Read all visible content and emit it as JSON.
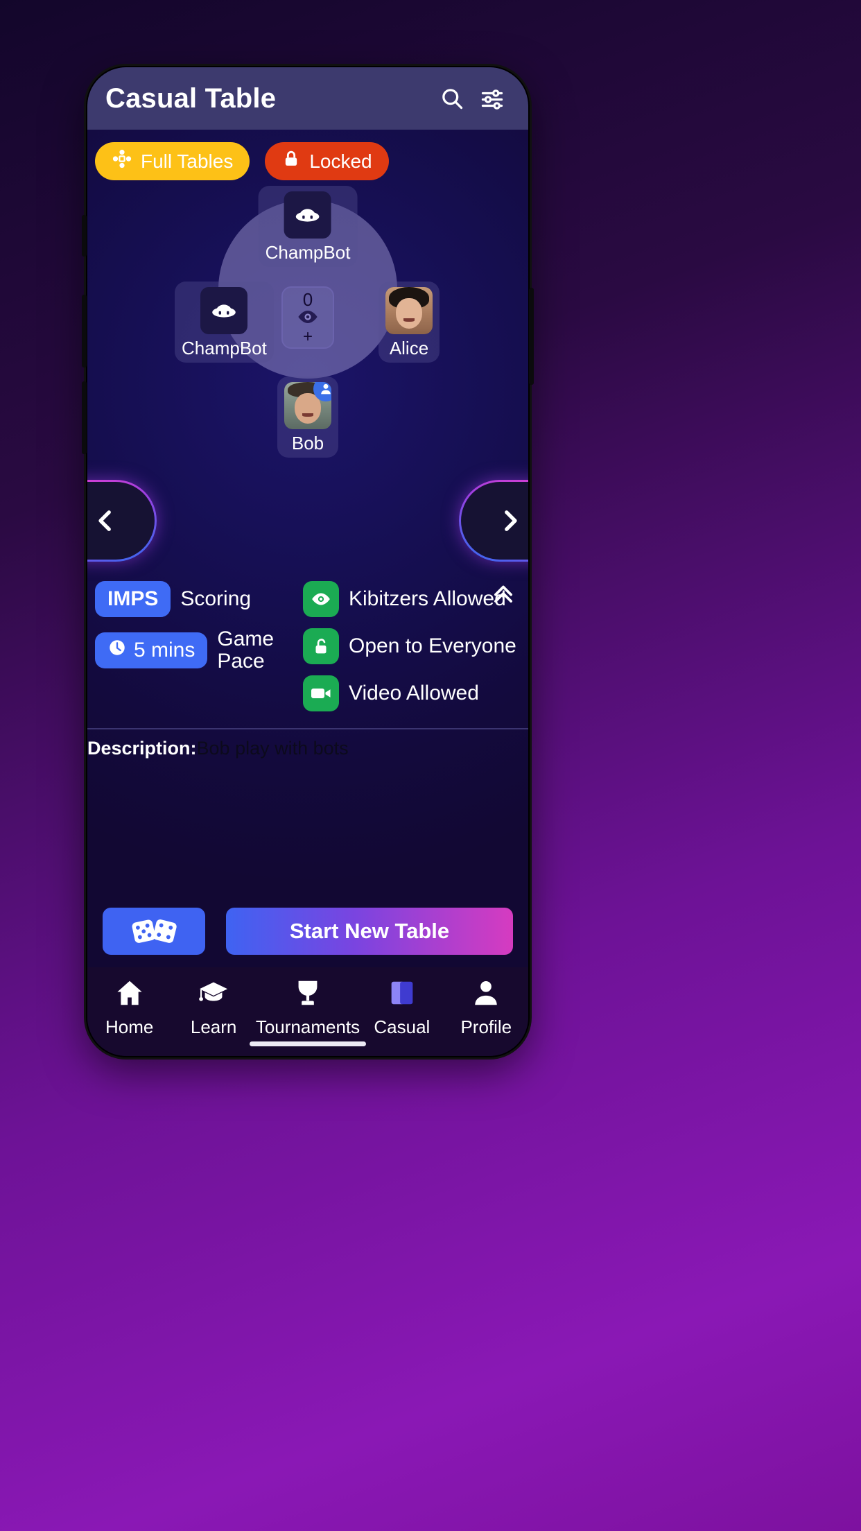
{
  "header": {
    "title": "Casual Table",
    "search_icon": "search-icon",
    "filter_icon": "sliders-icon"
  },
  "pills": [
    {
      "label": "Full Tables",
      "icon": "table-seats-icon",
      "color": "#fdc117"
    },
    {
      "label": "Locked",
      "icon": "lock-icon",
      "color": "#e03a12"
    }
  ],
  "table": {
    "seats": [
      {
        "position": "north",
        "name": "ChampBot",
        "avatar": "ufo-bot-icon",
        "is_bot": true,
        "owner": false
      },
      {
        "position": "west",
        "name": "ChampBot",
        "avatar": "ufo-bot-icon",
        "is_bot": true,
        "owner": false
      },
      {
        "position": "east",
        "name": "Alice",
        "avatar": "alice-photo",
        "is_bot": false,
        "owner": false
      },
      {
        "position": "south",
        "name": "Bob",
        "avatar": "bob-photo",
        "is_bot": false,
        "owner": true
      }
    ],
    "kibitzer": {
      "count": "0",
      "eye_icon": "eye-icon",
      "add_label": "+"
    },
    "prev_arrow": "chevron-left-icon",
    "next_arrow": "chevron-right-icon"
  },
  "settings": {
    "collapse_icon": "chevron-up-double-icon",
    "left": [
      {
        "badge": "IMPS",
        "badge_icon": null,
        "label": "Scoring",
        "badge_color": "#3f6bf5"
      },
      {
        "badge": "5 mins",
        "badge_icon": "clock-icon",
        "label": "Game Pace",
        "badge_color": "#3f6bf5"
      }
    ],
    "right": [
      {
        "icon": "eye-icon",
        "label": "Kibitzers Allowed",
        "icon_color": "#1bab53"
      },
      {
        "icon": "unlock-icon",
        "label": "Open to Everyone",
        "icon_color": "#1bab53"
      },
      {
        "icon": "video-icon",
        "label": "Video Allowed",
        "icon_color": "#1bab53"
      }
    ]
  },
  "description": {
    "label": "Description:",
    "text": "Bob play with bots"
  },
  "actions": {
    "dice_icon": "dice-icon",
    "start_label": "Start New Table"
  },
  "bottom_nav": [
    {
      "icon": "home-icon",
      "label": "Home"
    },
    {
      "icon": "graduation-cap-icon",
      "label": "Learn"
    },
    {
      "icon": "trophy-icon",
      "label": "Tournaments"
    },
    {
      "icon": "cards-icon",
      "label": "Casual"
    },
    {
      "icon": "person-icon",
      "label": "Profile"
    }
  ]
}
